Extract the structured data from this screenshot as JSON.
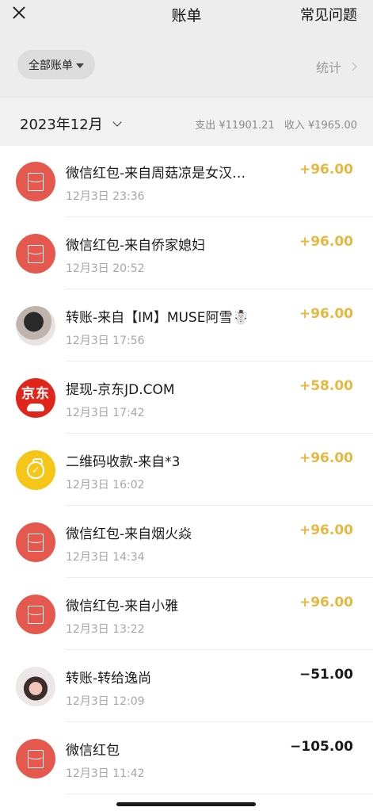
{
  "header": {
    "title": "账单",
    "faq_label": "常见问题"
  },
  "filter": {
    "label": "全部账单",
    "stats_label": "统计"
  },
  "month": {
    "label": "2023年12月",
    "summary_out": "支出 ¥11901.21",
    "summary_in": "收入 ¥1965.00"
  },
  "colors": {
    "income": "#e6b840",
    "expense": "#1a1a1a",
    "redpacket": "#e4584d"
  },
  "transactions": [
    {
      "icon": "red-packet-icon",
      "title": "微信红包-来自周菇凉是女汉…",
      "time": "12月3日 23:36",
      "amount": "+96.00",
      "type": "in"
    },
    {
      "icon": "red-packet-icon",
      "title": "微信红包-来自侨家媳妇",
      "time": "12月3日 20:52",
      "amount": "+96.00",
      "type": "in"
    },
    {
      "icon": "user-avatar-photo",
      "title": "转账-来自【IM】MUSE阿雪☃️",
      "time": "12月3日 17:56",
      "amount": "+96.00",
      "type": "in"
    },
    {
      "icon": "jd-logo-icon",
      "title": "提现-京东JD.COM",
      "time": "12月3日 17:42",
      "amount": "+58.00",
      "type": "in",
      "logo_text": "京东"
    },
    {
      "icon": "money-bag-icon",
      "title": "二维码收款-来自*3",
      "time": "12月3日 16:02",
      "amount": "+96.00",
      "type": "in"
    },
    {
      "icon": "red-packet-icon",
      "title": "微信红包-来自烟火焱",
      "time": "12月3日 14:34",
      "amount": "+96.00",
      "type": "in"
    },
    {
      "icon": "red-packet-icon",
      "title": "微信红包-来自小雅",
      "time": "12月3日 13:22",
      "amount": "+96.00",
      "type": "in"
    },
    {
      "icon": "user-avatar-photo",
      "title": "转账-转给逸尚",
      "time": "12月3日 12:09",
      "amount": "−51.00",
      "type": "out"
    },
    {
      "icon": "red-packet-icon",
      "title": "微信红包",
      "time": "12月3日 11:42",
      "amount": "−105.00",
      "type": "out"
    }
  ]
}
